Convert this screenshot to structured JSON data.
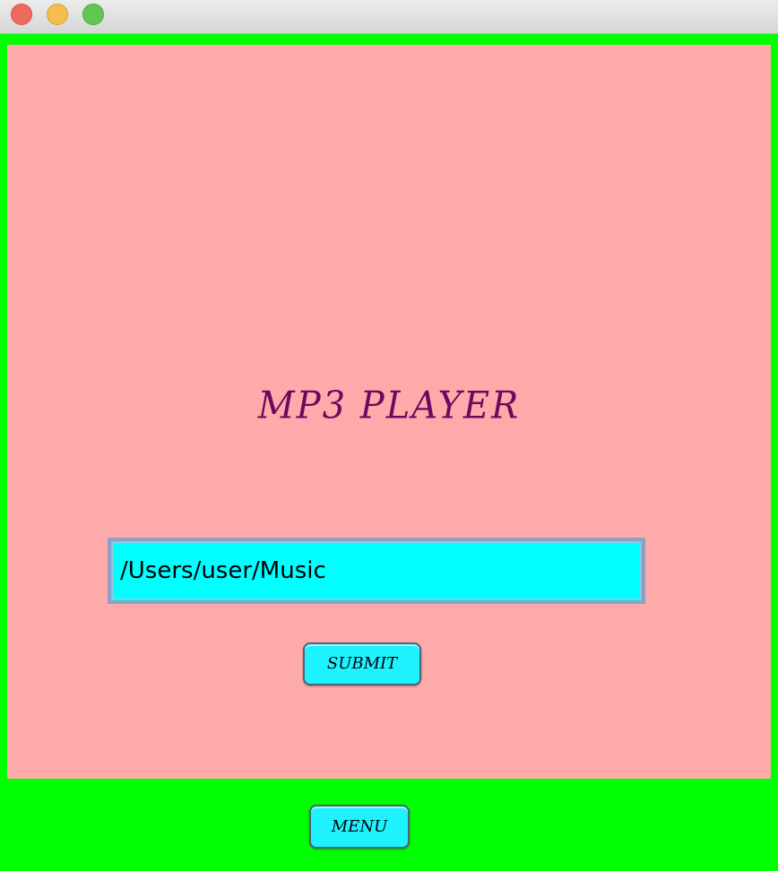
{
  "window": {
    "title": ""
  },
  "app": {
    "title": "MP3 PLAYER"
  },
  "path_field": {
    "value": "/Users/user/Music",
    "placeholder": ""
  },
  "buttons": {
    "submit_label": "SUBMIT",
    "menu_label": "MENU"
  },
  "colors": {
    "frame_background": "#00ff00",
    "panel_background": "#ffaaaa",
    "title_color": "#6a0a5e",
    "input_background": "#00ffff",
    "button_background": "#1ff2ff",
    "close_light": "#ee6a5e",
    "minimize_light": "#f6be4f",
    "zoom_light": "#62c554"
  }
}
